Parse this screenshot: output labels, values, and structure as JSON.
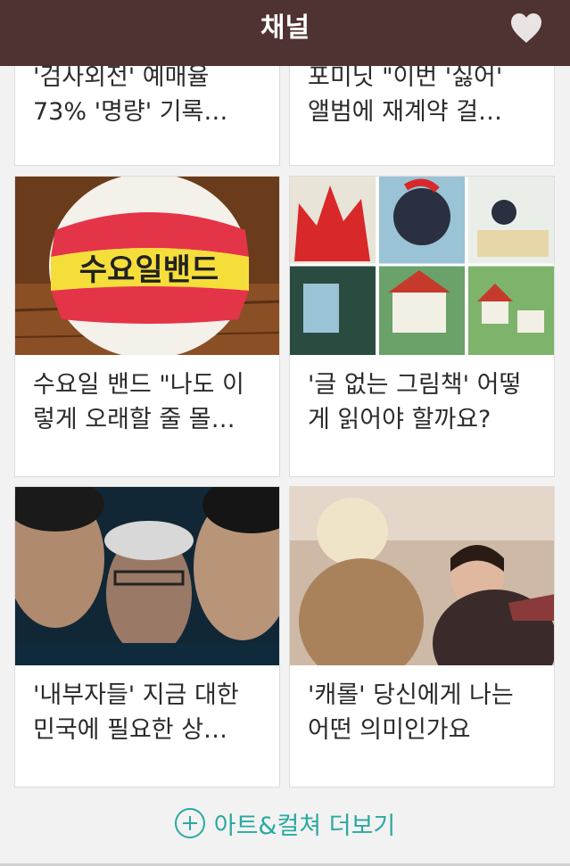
{
  "header": {
    "title": "채널",
    "favorite_icon": "heart-icon"
  },
  "cards": [
    {
      "title": "'검사외전' 예매율\n73% '명량' 기록…",
      "image": "partial"
    },
    {
      "title": "포미닛 \"이번 '싫어'\n앨범에 재계약 걸…",
      "image": "partial"
    },
    {
      "title": "수요일 밴드 \"나도 이\n렇게 오래할 줄 몰…",
      "image_text": "수요일밴드"
    },
    {
      "title": "'글 없는 그림책' 어떻\n게 읽어야 할까요?"
    },
    {
      "title": "'내부자들' 지금 대한\n민국에 필요한 상…"
    },
    {
      "title": "'캐롤' 당신에게 나는\n어떤 의미인가요"
    }
  ],
  "more": {
    "label": "아트&컬쳐 더보기",
    "icon": "plus-circle-icon"
  },
  "colors": {
    "header_bg": "#4f3232",
    "accent": "#2aa9a0"
  }
}
